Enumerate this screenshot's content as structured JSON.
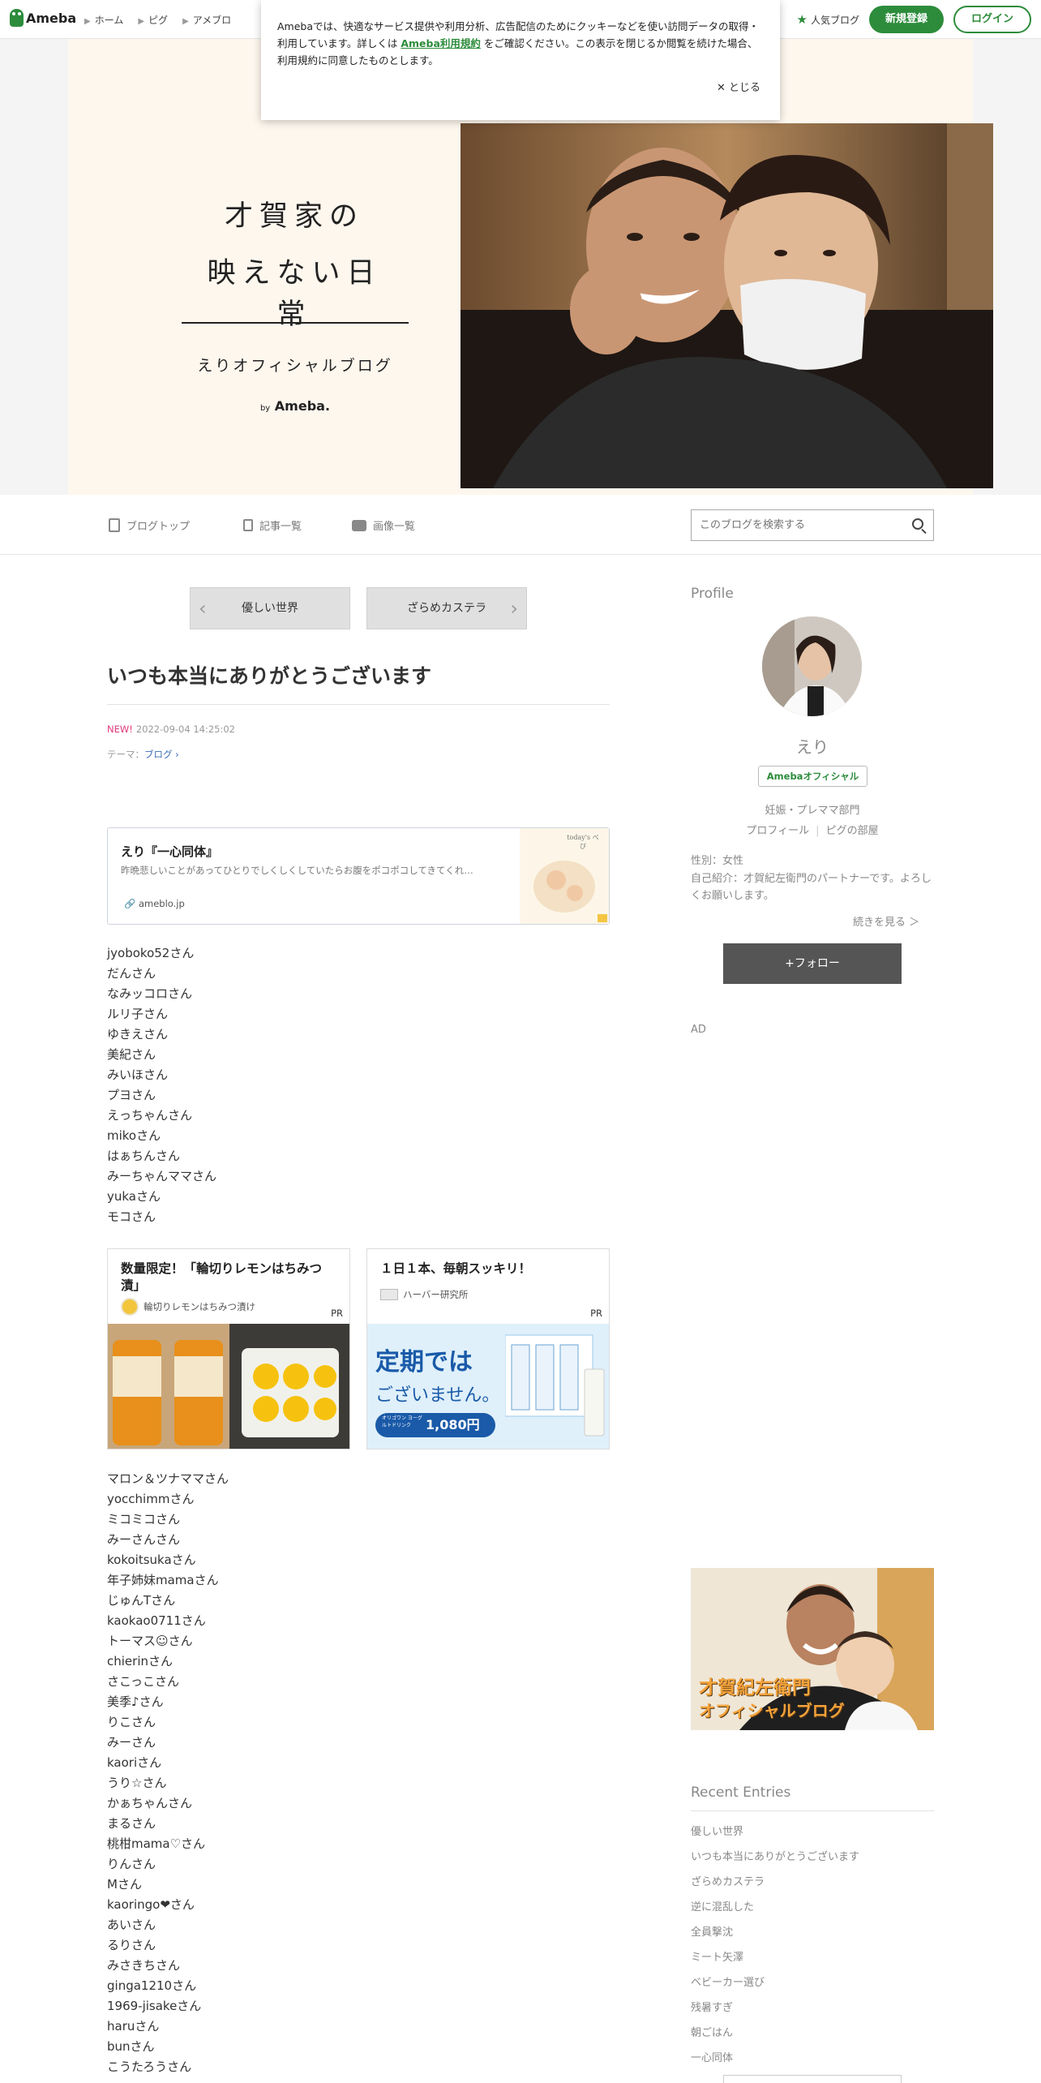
{
  "topnav": {
    "logo_text": "Ameba",
    "links": [
      "ホーム",
      "ピグ",
      "アメブロ"
    ],
    "popular_label": "人気ブログ",
    "signup_label": "新規登録",
    "login_label": "ログイン"
  },
  "cookie": {
    "text_before": "Amebaでは、快適なサービス提供や利用分析、広告配信のためにクッキーなどを使い訪問データの取得・利用しています。詳しくは ",
    "link": "Ameba利用規約",
    "text_after": " をご確認ください。この表示を閉じるか閲覧を続けた場合、利用規約に同意したものとします。",
    "close_label": "とじる"
  },
  "header": {
    "title_line1": "才賀家の",
    "title_line2": "映えない日常",
    "subtitle": "えりオフィシャルブログ",
    "by": "by",
    "brand": "Ameba."
  },
  "blogmenu": {
    "items": [
      "ブログトップ",
      "記事一覧",
      "画像一覧"
    ],
    "search_placeholder": "このブログを検索する"
  },
  "article": {
    "prev_label": "優しい世界",
    "next_label": "ざらめカステラ",
    "title": "いつも本当にありがとうございます",
    "new_badge": "NEW!",
    "datetime": "2022-09-04 14:25:02",
    "theme_label": "テーマ：",
    "theme_value": "ブログ",
    "linkcard": {
      "title": "えり『一心同体』",
      "desc": "昨晩悲しいことがあってひとりでしくしくしていたらお腹をポコポコしてきてくれ…",
      "host": "ameblo.jp",
      "thumb_text": "today's べび"
    },
    "names1": [
      "jyoboko52さん",
      "だんさん",
      "なみッコロさん",
      "ルリ子さん",
      "ゆきえさん",
      "美紀さん",
      "みいほさん",
      "プヨさん",
      "えっちゃんさん",
      "mikoさん",
      "はぁちんさん",
      "みーちゃんママさん",
      "yukaさん",
      "モコさん"
    ],
    "ads": [
      {
        "title": "数量限定！「輪切りレモンはちみつ漬」",
        "advertiser": "輪切りレモンはちみつ漬け",
        "pr": "PR"
      },
      {
        "title": "１日１本、毎朝スッキリ！",
        "advertiser": "ハーバー研究所",
        "pr": "PR",
        "img_main": "定期では",
        "img_sub": "ございません。",
        "img_price": "1,080円",
        "img_price_label": "オリゴワン ヨーグルトドリンク"
      }
    ],
    "names2": [
      "マロン＆ツナママさん",
      "yocchimmさん",
      "ミコミコさん",
      "みーさんさん",
      "kokoitsukaさん",
      "年子姉妹mamaさん",
      "じゅんTさん",
      "kaokao0711さん",
      "トーマス☺さん",
      "chierinさん",
      "さこっこさん",
      "美季♪さん",
      "りこさん",
      "みーさん",
      "kaoriさん",
      "うり☆さん",
      "かぁちゃんさん",
      "まるさん",
      "桃柑mama♡さん",
      "りんさん",
      "Mさん",
      "kaoringo❤さん",
      "あいさん",
      "るりさん",
      "みさきちさん",
      "ginga1210さん",
      "1969-jisakeさん",
      "haruさん",
      "bunさん",
      "こうたろうさん"
    ]
  },
  "sidebar": {
    "profile_heading": "Profile",
    "name": "えり",
    "official_badge": "Amebaオフィシャル",
    "category": "妊娠・プレママ部門",
    "profile_link": "プロフィール",
    "pig_link": "ピグの部屋",
    "gender": "性別：女性",
    "intro": "自己紹介：才賀紀左衛門のパートナーです。よろしくお願いします。",
    "more_label": "続きを見る ＞",
    "follow_label": "+フォロー",
    "ad_label": "AD",
    "banner_line1": "才賀紀左衛門",
    "banner_line2": "オフィシャルブログ",
    "recent_heading": "Recent Entries",
    "recent_entries": [
      "優しい世界",
      "いつも本当にありがとうございます",
      "ざらめカステラ",
      "逆に混乱した",
      "全員撃沈",
      "ミート矢澤",
      "ベビーカー選び",
      "残暑すぎ",
      "朝ごはん",
      "一心同体"
    ]
  },
  "colors": {
    "accent": "#2d8c3c",
    "new_badge": "#e0397c",
    "link": "#3a6db6"
  }
}
